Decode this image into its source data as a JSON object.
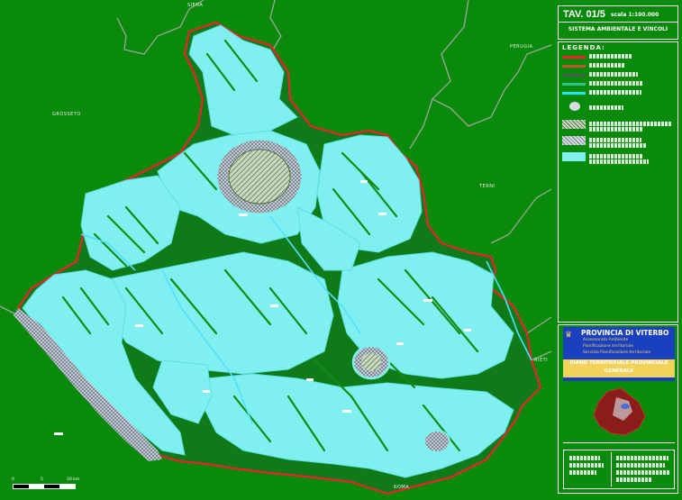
{
  "sheet": {
    "code": "TAV. 01/5",
    "scale": "scala 1:100.000",
    "theme": "SISTEMA AMBIENTALE E VINCOLI"
  },
  "legend": {
    "header": "LEGENDA:"
  },
  "place_labels": [
    "SIENA",
    "GROSSETO",
    "PERUGIA",
    "TERNI",
    "RIETI",
    "ROMA"
  ],
  "title_block": {
    "authority": "PROVINCIA DI VITERBO",
    "line1": "Assessorato Ambiente",
    "line2": "Pianificazione territoriale",
    "line3": "Servizio Pianificazione territoriale",
    "plan": "PIANO TERRITORIALE PROVINCIALE GENERALE"
  },
  "scale_bar": {
    "start": "0",
    "mid": "5",
    "end": "10 km"
  },
  "colors": {
    "background": "#0a8a0a",
    "water_zone": "#7ff0ef",
    "boundary": "#e8232b",
    "neighbor_border": "#9aa89a"
  }
}
